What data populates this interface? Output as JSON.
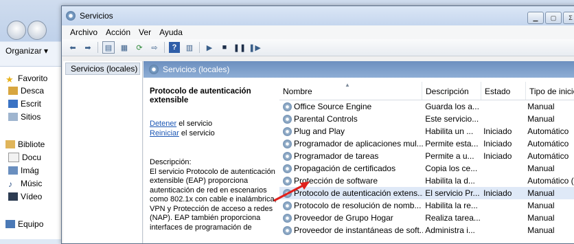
{
  "explorer": {
    "organize_label": "Organizar",
    "nav_items": [
      {
        "label": "Favorito",
        "icon": "star-icon"
      },
      {
        "label": "Desca",
        "icon": "downloads-icon"
      },
      {
        "label": "Escrit",
        "icon": "desktop-icon"
      },
      {
        "label": "Sitios",
        "icon": "recent-places-icon"
      },
      {
        "label": "Bibliote",
        "icon": "libraries-icon"
      },
      {
        "label": "Docu",
        "icon": "documents-icon"
      },
      {
        "label": "Imág",
        "icon": "pictures-icon"
      },
      {
        "label": "Músic",
        "icon": "music-icon"
      },
      {
        "label": "Vídeo",
        "icon": "videos-icon"
      },
      {
        "label": "Equipo",
        "icon": "computer-icon"
      }
    ]
  },
  "window": {
    "title": "Servicios",
    "menu": [
      "Archivo",
      "Acción",
      "Ver",
      "Ayuda"
    ],
    "tree_item": "Servicios (locales)",
    "pane_title": "Servicios (locales)"
  },
  "details": {
    "service_name": "Protocolo de autenticación extensible",
    "stop_link": "Detener",
    "stop_suffix": " el servicio",
    "restart_link": "Reiniciar",
    "restart_suffix": " el servicio",
    "desc_label": "Descripción:",
    "desc_text": "El servicio Protocolo de autenticación extensible (EAP) proporciona autenticación de red en escenarios como 802.1x con cable e inalámbrica, VPN y Protección de acceso a redes (NAP). EAP también proporciona interfaces de programación de"
  },
  "table": {
    "columns": [
      "Nombre",
      "Descripción",
      "Estado",
      "Tipo de inicio"
    ],
    "rows": [
      {
        "name": "Office Source Engine",
        "desc": "Guarda los a...",
        "status": "",
        "start": "Manual"
      },
      {
        "name": "Parental Controls",
        "desc": "Este servicio...",
        "status": "",
        "start": "Manual"
      },
      {
        "name": "Plug and Play",
        "desc": "Habilita un ...",
        "status": "Iniciado",
        "start": "Automático"
      },
      {
        "name": "Programador de aplicaciones mul...",
        "desc": "Permite esta...",
        "status": "Iniciado",
        "start": "Automático"
      },
      {
        "name": "Programador de tareas",
        "desc": "Permite a u...",
        "status": "Iniciado",
        "start": "Automático"
      },
      {
        "name": "Propagación de certificados",
        "desc": "Copia los ce...",
        "status": "",
        "start": "Manual"
      },
      {
        "name": "Protección de software",
        "desc": "Habilita la d...",
        "status": "",
        "start": "Automático (i..."
      },
      {
        "name": "Protocolo de autenticación extens...",
        "desc": "El servicio Pr...",
        "status": "Iniciado",
        "start": "Manual"
      },
      {
        "name": "Protocolo de resolución de nomb...",
        "desc": "Habilita la re...",
        "status": "",
        "start": "Manual"
      },
      {
        "name": "Proveedor de Grupo Hogar",
        "desc": "Realiza tarea...",
        "status": "",
        "start": "Manual"
      },
      {
        "name": "Proveedor de instantáneas de soft...",
        "desc": "Administra i...",
        "status": "",
        "start": "Manual"
      }
    ],
    "selected_index": 7
  },
  "colors": {
    "annotation_arrow": "#e0201c",
    "link": "#1a55b4",
    "pane_header": "#7b9cc8"
  }
}
